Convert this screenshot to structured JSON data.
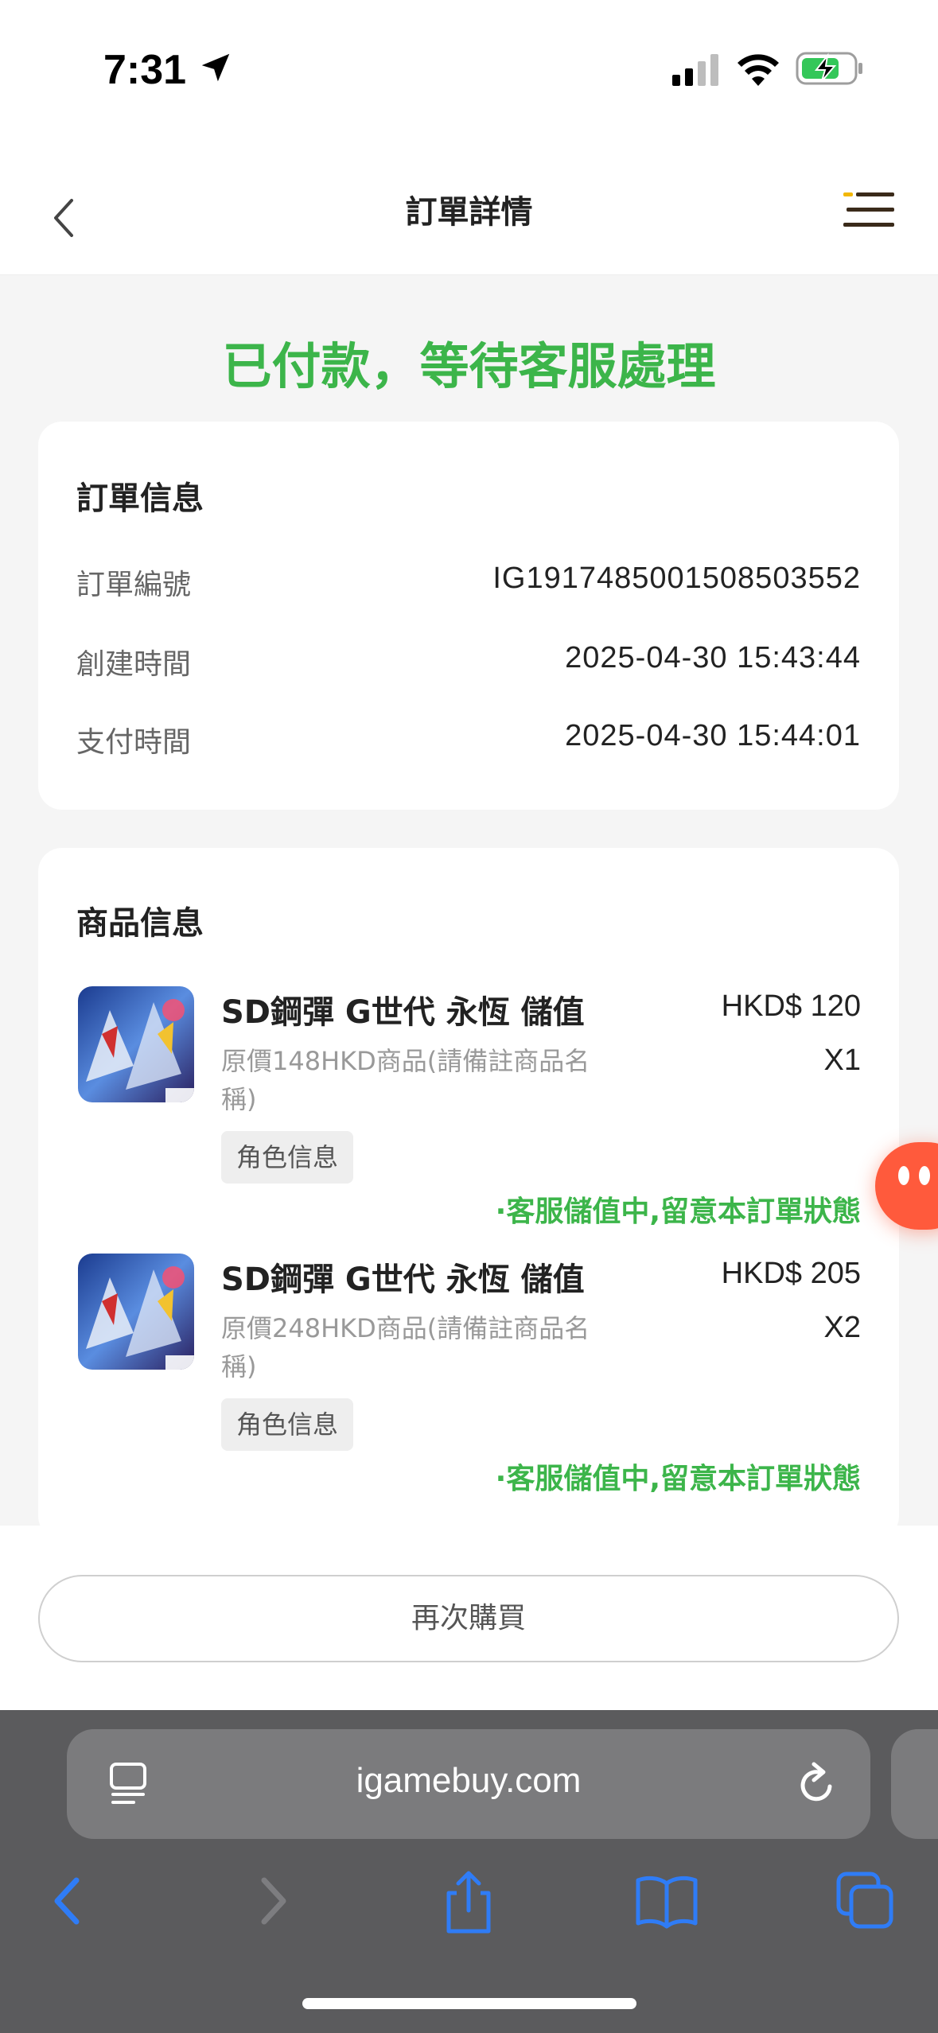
{
  "status_bar": {
    "time": "7:31"
  },
  "nav": {
    "title": "訂單詳情"
  },
  "order_status": "已付款，等待客服處理",
  "order_info": {
    "title": "訂單信息",
    "rows": [
      {
        "label": "訂單編號",
        "value": "IG1917485001508503552"
      },
      {
        "label": "創建時間",
        "value": "2025-04-30 15:43:44"
      },
      {
        "label": "支付時間",
        "value": "2025-04-30 15:44:01"
      }
    ]
  },
  "product_info": {
    "title": "商品信息",
    "items": [
      {
        "name": "SD鋼彈 G世代 永恆 儲值",
        "desc_line1": "原價148HKD商品(請備註商品名",
        "desc_line2": "稱)",
        "tag": "角色信息",
        "price": "HKD$ 120",
        "qty": "X1",
        "status": "·客服儲值中,留意本訂單狀態"
      },
      {
        "name": "SD鋼彈 G世代 永恆 儲值",
        "desc_line1": "原價248HKD商品(請備註商品名",
        "desc_line2": "稱)",
        "tag": "角色信息",
        "price": "HKD$ 205",
        "qty": "X2",
        "status": "·客服儲值中,留意本訂單狀態"
      }
    ]
  },
  "actions": {
    "rebuy_label": "再次購買"
  },
  "browser": {
    "url": "igamebuy.com"
  },
  "colors": {
    "accent_green": "#3cb54a",
    "chat_orange": "#ff5a3c",
    "ios_blue": "#2f7cf6"
  }
}
